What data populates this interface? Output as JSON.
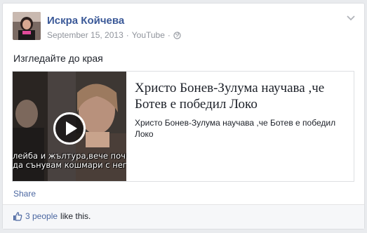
{
  "post": {
    "author": "Искра Койчева",
    "date": "September 15, 2013",
    "separator": "·",
    "source": "YouTube",
    "separator2": "·",
    "text": "Изгледайте до края"
  },
  "shared_link": {
    "title": "Христо Бонев-Зулума научава ,че Ботев е победил Локо",
    "description": "Христо Бонев-Зулума научава ,че Ботев е победил Локо",
    "video_subtitle_line1": "лейба и жълтура,вече  почва",
    "video_subtitle_line2": "да сънувам кошмари с него"
  },
  "actions": {
    "share_label": "Share"
  },
  "likes": {
    "count_label": "3 people",
    "suffix": "like this."
  },
  "colors": {
    "link_blue": "#3b5998",
    "action_blue": "#4b67a1",
    "meta_gray": "#90949c"
  },
  "icons": {
    "audience": "globe-icon",
    "menu": "chevron-down-icon",
    "like": "thumbs-up-icon",
    "play": "play-icon"
  }
}
